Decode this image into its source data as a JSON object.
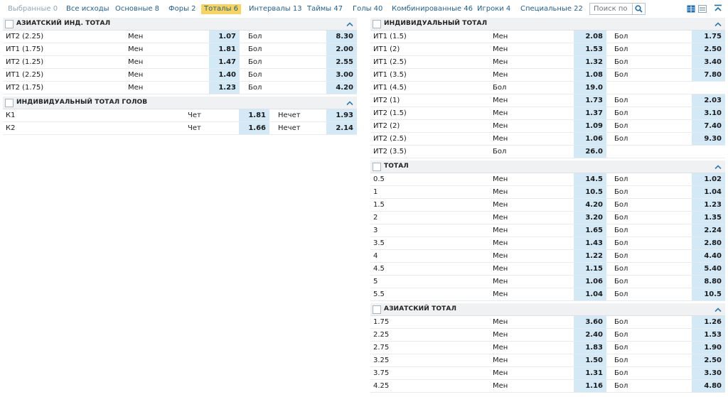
{
  "tabs": [
    {
      "label": "Выбранные 0",
      "active": false
    },
    {
      "label": "Все исходы",
      "active": false
    },
    {
      "label": "Основные 8",
      "active": false
    },
    {
      "label": "Форы 2",
      "active": false
    },
    {
      "label": "Тоталы 6",
      "active": true
    },
    {
      "label": "Интервалы 13",
      "active": false
    },
    {
      "label": "Таймы 47",
      "active": false
    },
    {
      "label": "Голы 40",
      "active": false
    },
    {
      "label": "Комбинированные 46",
      "active": false
    },
    {
      "label": "Игроки 4",
      "active": false
    },
    {
      "label": "Специальные 22",
      "active": false
    }
  ],
  "search": {
    "placeholder": "Поиск по"
  },
  "icons": {
    "search": "search-icon",
    "chevron": "chevron-up-icon",
    "grid": "two-column-view-icon",
    "list": "one-column-view-icon",
    "collapse": "collapse-all-icon"
  },
  "colors": {
    "accent": "#f8d45e",
    "odds_bg": "#d4e9f6",
    "link": "#1c5f94"
  },
  "left": [
    {
      "title": "АЗИАТСКИЙ ИНД. ТОТАЛ",
      "rows": [
        {
          "name": "ИТ2 (2.25)",
          "l1": "Мен",
          "o1": "1.07",
          "l2": "Бол",
          "o2": "8.30"
        },
        {
          "name": "ИТ1 (1.75)",
          "l1": "Мен",
          "o1": "1.81",
          "l2": "Бол",
          "o2": "2.00"
        },
        {
          "name": "ИТ2 (1.25)",
          "l1": "Мен",
          "o1": "1.47",
          "l2": "Бол",
          "o2": "2.55"
        },
        {
          "name": "ИТ1 (2.25)",
          "l1": "Мен",
          "o1": "1.40",
          "l2": "Бол",
          "o2": "3.00"
        },
        {
          "name": "ИТ2 (1.75)",
          "l1": "Мен",
          "o1": "1.23",
          "l2": "Бол",
          "o2": "4.20"
        }
      ]
    },
    {
      "title": "ИНДИВИДУАЛЬНЫЙ ТОТАЛ ГОЛОВ",
      "rows": [
        {
          "name": "К1",
          "l1": "Чет",
          "o1": "1.81",
          "l2": "Нечет",
          "o2": "1.93"
        },
        {
          "name": "К2",
          "l1": "Чет",
          "o1": "1.66",
          "l2": "Нечет",
          "o2": "2.14"
        }
      ]
    }
  ],
  "right": [
    {
      "title": "ИНДИВИДУАЛЬНЫЙ ТОТАЛ",
      "rows": [
        {
          "name": "ИТ1 (1.5)",
          "l1": "Мен",
          "o1": "2.08",
          "l2": "Бол",
          "o2": "1.75"
        },
        {
          "name": "ИТ1 (2)",
          "l1": "Мен",
          "o1": "1.53",
          "l2": "Бол",
          "o2": "2.50"
        },
        {
          "name": "ИТ1 (2.5)",
          "l1": "Мен",
          "o1": "1.32",
          "l2": "Бол",
          "o2": "3.40"
        },
        {
          "name": "ИТ1 (3.5)",
          "l1": "Мен",
          "o1": "1.08",
          "l2": "Бол",
          "o2": "7.80"
        },
        {
          "name": "ИТ1 (4.5)",
          "l1": "Бол",
          "o1": "19.0",
          "l2": "",
          "o2": ""
        },
        {
          "name": "ИТ2 (1)",
          "l1": "Мен",
          "o1": "1.73",
          "l2": "Бол",
          "o2": "2.03"
        },
        {
          "name": "ИТ2 (1.5)",
          "l1": "Мен",
          "o1": "1.37",
          "l2": "Бол",
          "o2": "3.10"
        },
        {
          "name": "ИТ2 (2)",
          "l1": "Мен",
          "o1": "1.09",
          "l2": "Бол",
          "o2": "7.40"
        },
        {
          "name": "ИТ2 (2.5)",
          "l1": "Мен",
          "o1": "1.06",
          "l2": "Бол",
          "o2": "9.30"
        },
        {
          "name": "ИТ2 (3.5)",
          "l1": "Бол",
          "o1": "26.0",
          "l2": "",
          "o2": ""
        }
      ]
    },
    {
      "title": "ТОТАЛ",
      "rows": [
        {
          "name": "0.5",
          "l1": "Мен",
          "o1": "14.5",
          "l2": "Бол",
          "o2": "1.02"
        },
        {
          "name": "1",
          "l1": "Мен",
          "o1": "10.5",
          "l2": "Бол",
          "o2": "1.04"
        },
        {
          "name": "1.5",
          "l1": "Мен",
          "o1": "4.20",
          "l2": "Бол",
          "o2": "1.23"
        },
        {
          "name": "2",
          "l1": "Мен",
          "o1": "3.20",
          "l2": "Бол",
          "o2": "1.35"
        },
        {
          "name": "3",
          "l1": "Мен",
          "o1": "1.65",
          "l2": "Бол",
          "o2": "2.24"
        },
        {
          "name": "3.5",
          "l1": "Мен",
          "o1": "1.43",
          "l2": "Бол",
          "o2": "2.80"
        },
        {
          "name": "4",
          "l1": "Мен",
          "o1": "1.22",
          "l2": "Бол",
          "o2": "4.40"
        },
        {
          "name": "4.5",
          "l1": "Мен",
          "o1": "1.15",
          "l2": "Бол",
          "o2": "5.40"
        },
        {
          "name": "5",
          "l1": "Мен",
          "o1": "1.06",
          "l2": "Бол",
          "o2": "8.80"
        },
        {
          "name": "5.5",
          "l1": "Мен",
          "o1": "1.04",
          "l2": "Бол",
          "o2": "10.5"
        }
      ]
    },
    {
      "title": "АЗИАТСКИЙ ТОТАЛ",
      "rows": [
        {
          "name": "1.75",
          "l1": "Мен",
          "o1": "3.60",
          "l2": "Бол",
          "o2": "1.26"
        },
        {
          "name": "2.25",
          "l1": "Мен",
          "o1": "2.40",
          "l2": "Бол",
          "o2": "1.53"
        },
        {
          "name": "2.75",
          "l1": "Мен",
          "o1": "1.83",
          "l2": "Бол",
          "o2": "1.90"
        },
        {
          "name": "3.25",
          "l1": "Мен",
          "o1": "1.50",
          "l2": "Бол",
          "o2": "2.50"
        },
        {
          "name": "3.75",
          "l1": "Мен",
          "o1": "1.31",
          "l2": "Бол",
          "o2": "3.30"
        },
        {
          "name": "4.25",
          "l1": "Мен",
          "o1": "1.16",
          "l2": "Бол",
          "o2": "4.80"
        }
      ]
    }
  ]
}
